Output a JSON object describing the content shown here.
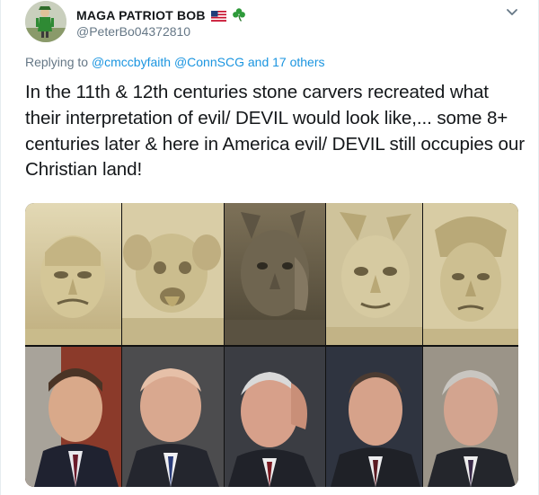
{
  "author": {
    "display_name": "MAGA PATRIOT BOB",
    "handle": "@PeterBo04372810",
    "avatar_icon": "profile-photo-figure",
    "badges": [
      "us-flag-icon",
      "shamrock-icon"
    ]
  },
  "menu": {
    "icon": "chevron-down-icon"
  },
  "reply": {
    "prefix": "Replying to",
    "mention1": "@cmccbyfaith",
    "mention2": "@ConnSCG",
    "and": "and",
    "others": "17 others"
  },
  "tweet": {
    "text": "In the 11th & 12th centuries stone carvers recreated what their interpretation of evil/ DEVIL would look like,... some 8+ centuries later & here in America evil/ DEVIL still occupies our Christian land!"
  },
  "media": {
    "top_row": [
      "stone-gargoyle-1",
      "stone-gargoyle-2",
      "stone-gargoyle-3",
      "stone-gargoyle-4",
      "stone-gargoyle-5"
    ],
    "bottom_row": [
      "portrait-1",
      "portrait-2",
      "portrait-3",
      "portrait-4",
      "portrait-5"
    ]
  },
  "colors": {
    "link": "#1b95e0",
    "muted": "#657786",
    "text": "#14171a",
    "stone": "#d9cfa8"
  }
}
